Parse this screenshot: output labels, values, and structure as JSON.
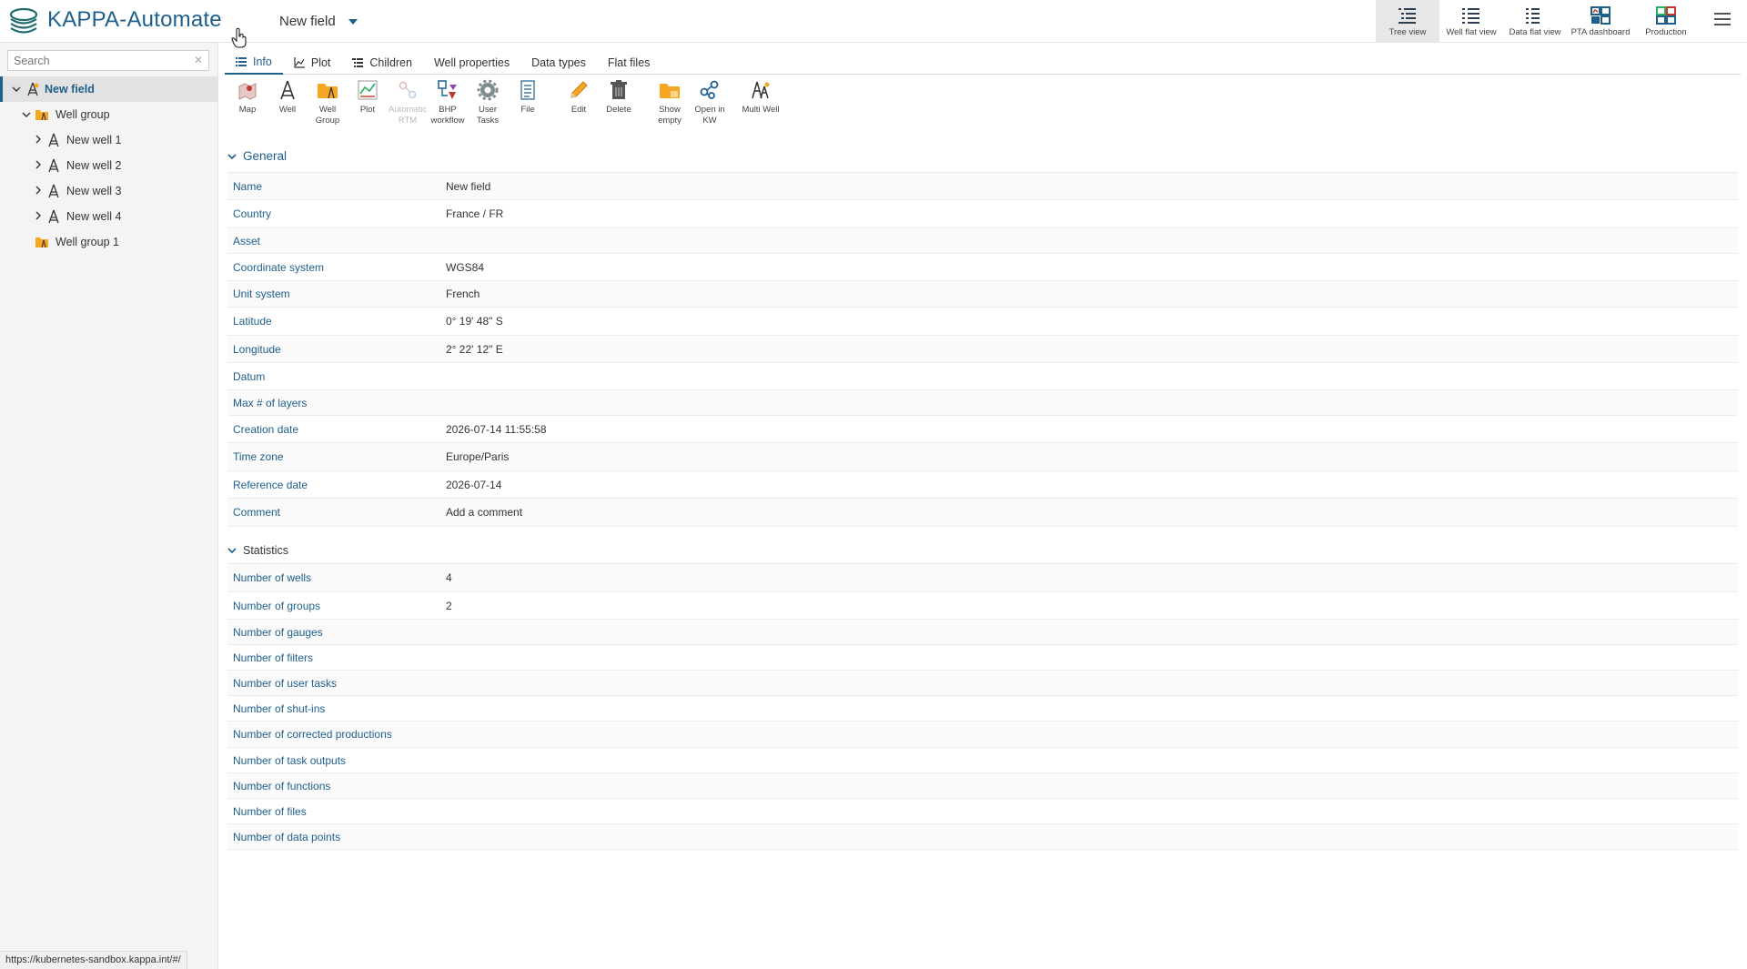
{
  "app": {
    "title": "KAPPA-Automate"
  },
  "field_selector": {
    "label": "New field"
  },
  "views": [
    {
      "label": "Tree view",
      "icon": "tree-view-icon"
    },
    {
      "label": "Well flat view",
      "icon": "well-flat-view-icon"
    },
    {
      "label": "Data flat view",
      "icon": "data-flat-view-icon"
    },
    {
      "label": "PTA dashboard",
      "icon": "pta-dashboard-icon"
    },
    {
      "label": "Production",
      "icon": "production-icon"
    }
  ],
  "sidebar": {
    "search_placeholder": "Search",
    "tree": [
      {
        "label": "New field",
        "icon": "field-icon",
        "level": 0,
        "expanded": true,
        "selected": true
      },
      {
        "label": "Well group",
        "icon": "well-group-icon",
        "level": 1,
        "expanded": true
      },
      {
        "label": "New well 1",
        "icon": "well-icon",
        "level": 2,
        "expanded": false
      },
      {
        "label": "New well 2",
        "icon": "well-icon",
        "level": 2,
        "expanded": false
      },
      {
        "label": "New well 3",
        "icon": "well-icon",
        "level": 2,
        "expanded": false
      },
      {
        "label": "New well 4",
        "icon": "well-icon",
        "level": 2,
        "expanded": false
      },
      {
        "label": "Well group 1",
        "icon": "well-group-icon",
        "level": 1
      }
    ]
  },
  "status_url": "https://kubernetes-sandbox.kappa.int/#/",
  "tabs": [
    {
      "label": "Info",
      "active": true
    },
    {
      "label": "Plot"
    },
    {
      "label": "Children"
    },
    {
      "label": "Well properties"
    },
    {
      "label": "Data types"
    },
    {
      "label": "Flat files"
    }
  ],
  "toolbar": [
    {
      "label": "Map"
    },
    {
      "label": "Well"
    },
    {
      "label": "Well Group"
    },
    {
      "label": "Plot"
    },
    {
      "label": "Automatic RTM",
      "disabled": true
    },
    {
      "label": "BHP workflow"
    },
    {
      "label": "User Tasks"
    },
    {
      "label": "File"
    },
    {
      "label": "Edit"
    },
    {
      "label": "Delete"
    },
    {
      "label": "Show empty"
    },
    {
      "label": "Open in KW"
    },
    {
      "label": "Multi Well"
    }
  ],
  "general": {
    "title": "General",
    "rows": [
      {
        "key": "Name",
        "value": "New field"
      },
      {
        "key": "Country",
        "value": "France / FR"
      },
      {
        "key": "Asset",
        "value": ""
      },
      {
        "key": "Coordinate system",
        "value": "WGS84"
      },
      {
        "key": "Unit system",
        "value": "French"
      },
      {
        "key": "Latitude",
        "value": "0° 19' 48\" S"
      },
      {
        "key": "Longitude",
        "value": "2° 22' 12\" E"
      },
      {
        "key": "Datum",
        "value": ""
      },
      {
        "key": "Max # of layers",
        "value": ""
      },
      {
        "key": "Creation date",
        "value": "2026-07-14 11:55:58"
      },
      {
        "key": "Time zone",
        "value": "Europe/Paris"
      },
      {
        "key": "Reference date",
        "value": "2026-07-14"
      },
      {
        "key": "Comment",
        "value": "Add a comment"
      }
    ]
  },
  "statistics": {
    "title": "Statistics",
    "rows": [
      {
        "key": "Number of wells",
        "value": "4"
      },
      {
        "key": "Number of groups",
        "value": "2"
      },
      {
        "key": "Number of gauges",
        "value": ""
      },
      {
        "key": "Number of filters",
        "value": ""
      },
      {
        "key": "Number of user tasks",
        "value": ""
      },
      {
        "key": "Number of shut-ins",
        "value": ""
      },
      {
        "key": "Number of corrected productions",
        "value": ""
      },
      {
        "key": "Number of task outputs",
        "value": ""
      },
      {
        "key": "Number of functions",
        "value": ""
      },
      {
        "key": "Number of files",
        "value": ""
      },
      {
        "key": "Number of data points",
        "value": ""
      }
    ]
  },
  "colors": {
    "accent": "#1e5f8c",
    "sidebar_bg": "#f4f4f4",
    "group_folder": "#f5a623"
  }
}
